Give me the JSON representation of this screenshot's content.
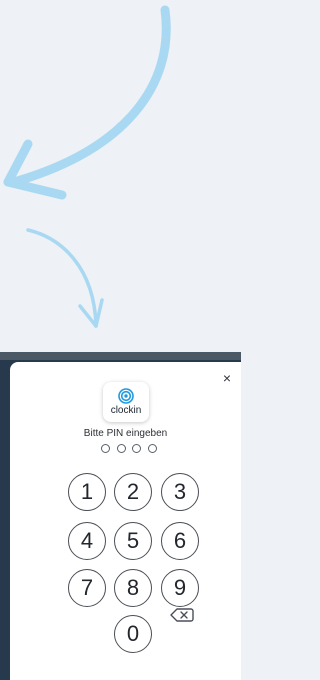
{
  "app": {
    "logo_text": "clockin"
  },
  "pin_dialog": {
    "title": "Bitte PIN eingeben",
    "pin_length": 4,
    "close_label": "×",
    "keys": [
      "1",
      "2",
      "3",
      "4",
      "5",
      "6",
      "7",
      "8",
      "9",
      "0"
    ],
    "backspace_icon": "backspace-icon"
  },
  "colors": {
    "arrow": "#a9d9f2",
    "page_background": "#eef1f5",
    "backdrop": "#27394d",
    "key_border": "#4a4f56",
    "logo_blue": "#1e9be0"
  }
}
